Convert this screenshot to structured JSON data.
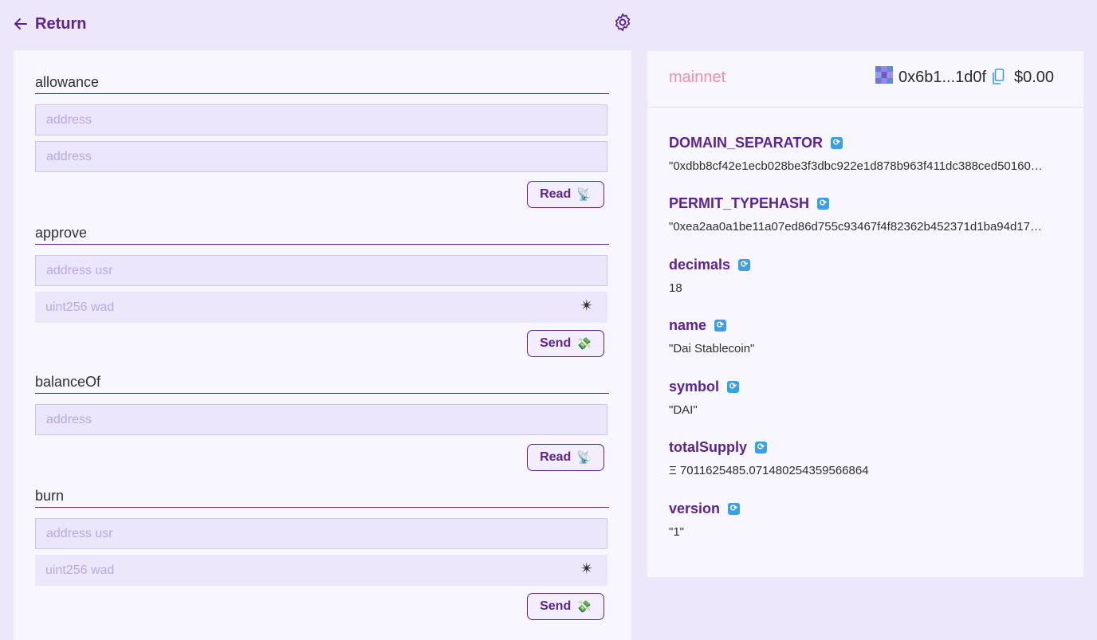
{
  "header": {
    "back_label": "Return"
  },
  "functions": [
    {
      "name": "allowance",
      "inputs": [
        "address",
        "address"
      ],
      "action": "Read",
      "action_emoji": "📡"
    },
    {
      "name": "approve",
      "inputs": [
        "address usr",
        "uint256 wad"
      ],
      "action": "Send",
      "action_emoji": "💸"
    },
    {
      "name": "balanceOf",
      "inputs": [
        "address"
      ],
      "action": "Read",
      "action_emoji": "📡"
    },
    {
      "name": "burn",
      "inputs": [
        "address usr",
        "uint256 wad"
      ],
      "action": "Send",
      "action_emoji": "💸"
    }
  ],
  "uint_icon": "✴",
  "account": {
    "network": "mainnet",
    "address": "0x6b1...1d0f",
    "balance": "$0.00"
  },
  "properties": [
    {
      "name": "DOMAIN_SEPARATOR",
      "value": "\"0xdbb8cf42e1ecb028be3f3dbc922e1d878b963f411dc388ced50160…"
    },
    {
      "name": "PERMIT_TYPEHASH",
      "value": "\"0xea2aa0a1be11a07ed86d755c93467f4f82362b452371d1ba94d17…"
    },
    {
      "name": "decimals",
      "value": "18"
    },
    {
      "name": "name",
      "value": "\"Dai Stablecoin\""
    },
    {
      "name": "symbol",
      "value": "\"DAI\""
    },
    {
      "name": "totalSupply",
      "value": "Ξ 7011625485.071480254359566864"
    },
    {
      "name": "version",
      "value": "\"1\""
    }
  ],
  "refresh_glyph": "🔄",
  "icons": {
    "back": "arrow-left-icon",
    "settings": "gear-icon",
    "copy": "copy-icon"
  },
  "colors": {
    "accent": "#5b2396",
    "network": "#f08fa6",
    "background": "#ede7fc"
  }
}
